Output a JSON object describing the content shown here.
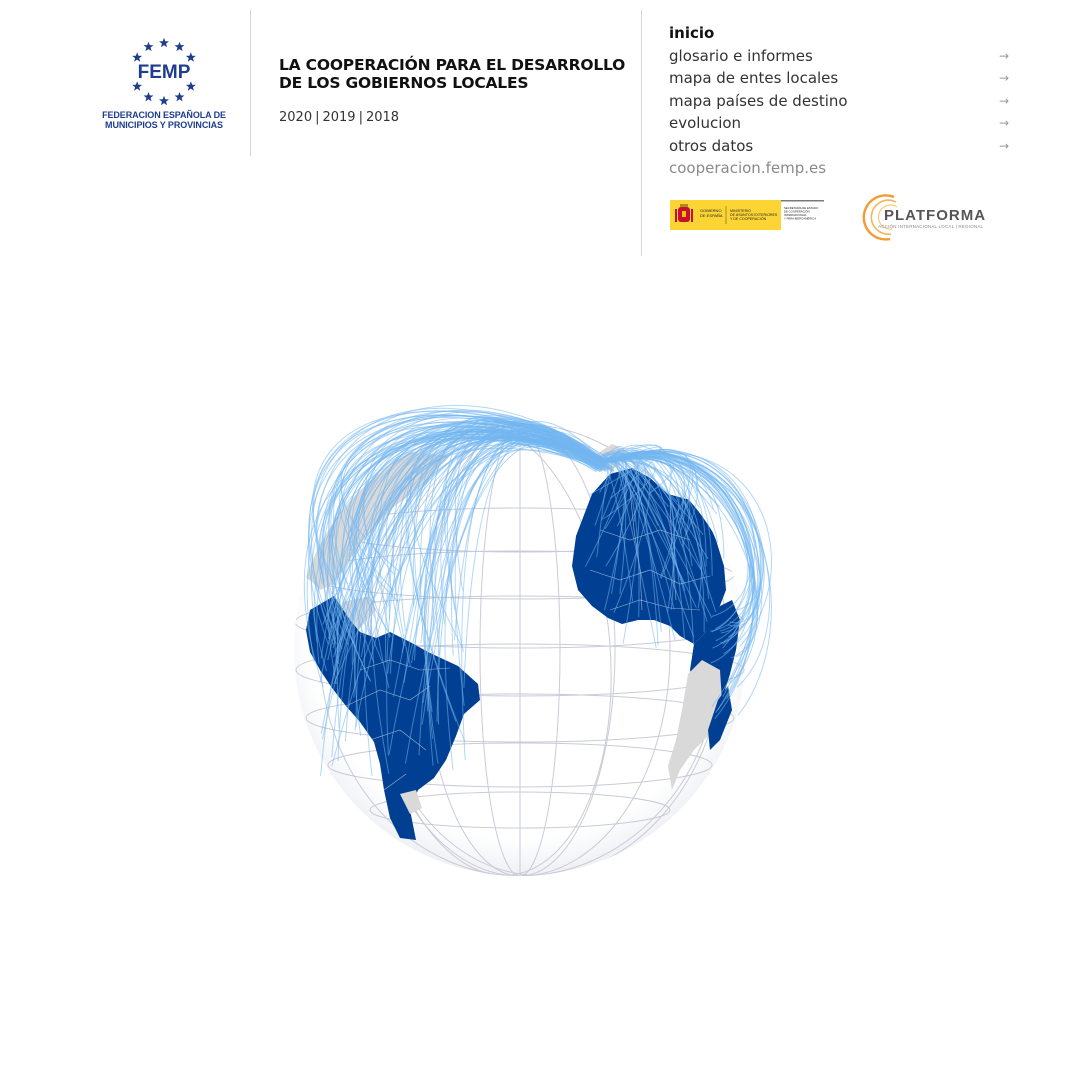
{
  "logo": {
    "mark": "FEMP",
    "caption_line1": "FEDERACION ESPAÑOLA DE",
    "caption_line2": "MUNICIPIOS Y PROVINCIAS"
  },
  "header": {
    "title_line1": "LA COOPERACIÓN PARA EL DESARROLLO",
    "title_line2": "DE LOS GOBIERNOS LOCALES",
    "years": [
      "2020",
      "2019",
      "2018"
    ]
  },
  "nav": {
    "items": [
      {
        "label": "inicio",
        "arrow": ""
      },
      {
        "label": "glosario e informes",
        "arrow": "→"
      },
      {
        "label": "mapa de entes locales",
        "arrow": "→"
      },
      {
        "label": "mapa países de destino",
        "arrow": "→"
      },
      {
        "label": "evolucion",
        "arrow": "→"
      },
      {
        "label": "otros datos",
        "arrow": "→"
      }
    ],
    "url": "cooperacion.femp.es"
  },
  "partners": {
    "gobierno_text": "GOBIERNO DE ESPAÑA",
    "ministerio_text": "MINISTERIO DE ASUNTOS EXTERIORES Y DE COOPERACIÓN",
    "secretaria_text": "SECRETARÍA DE ESTADO DE COOPERACIÓN INTERNACIONAL Y PARA IBEROAMÉRICA",
    "platforma_name": "PLATFORMA",
    "platforma_sub": "ACCIÓN INTERNACIONAL LOCAL | REGIONAL"
  },
  "map": {
    "colors": {
      "highlighted": "#003f91",
      "other_land": "#d9d9d9",
      "flows": "#73b6f0",
      "graticule": "#c9ccd8"
    }
  }
}
